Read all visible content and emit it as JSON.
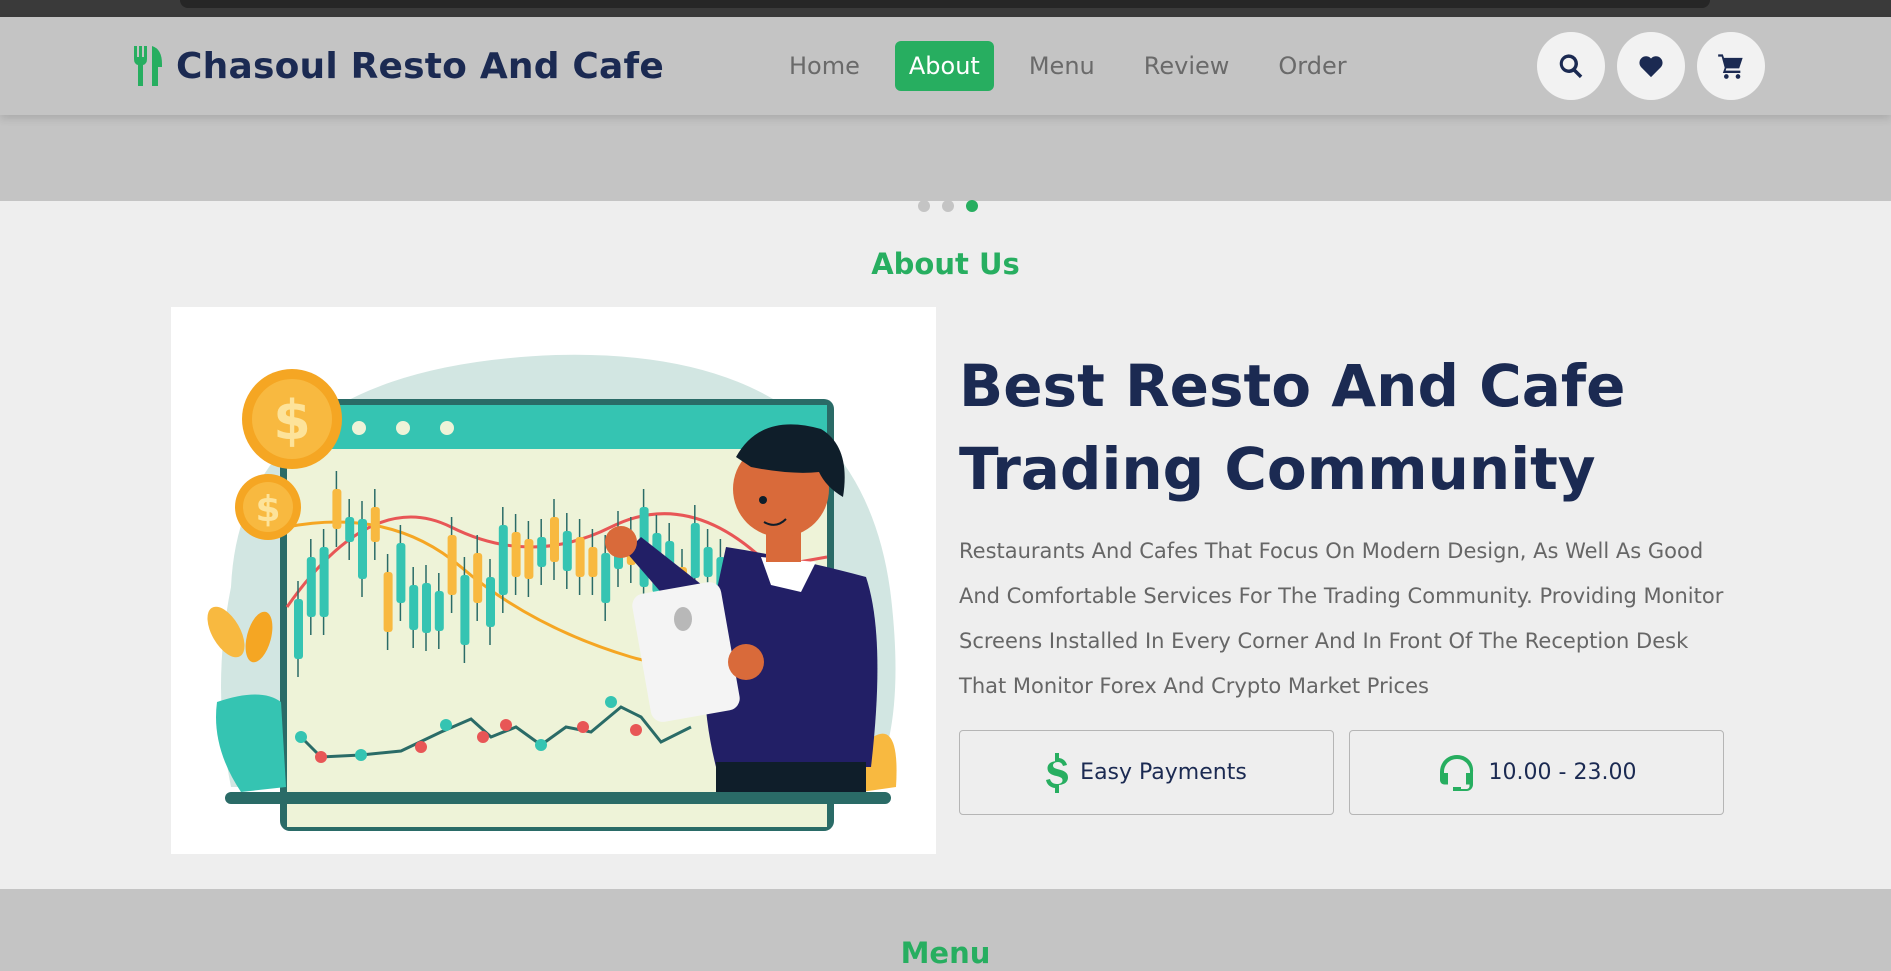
{
  "header": {
    "logo_text": "Chasoul Resto And Cafe",
    "logo_icon": "utensils-icon",
    "nav": [
      {
        "label": "Home",
        "active": false
      },
      {
        "label": "About",
        "active": true
      },
      {
        "label": "Menu",
        "active": false
      },
      {
        "label": "Review",
        "active": false
      },
      {
        "label": "Order",
        "active": false
      }
    ],
    "icons": [
      "search-icon",
      "heart-icon",
      "cart-icon"
    ]
  },
  "slider": {
    "dots": 3,
    "active_dot": 3
  },
  "about": {
    "section_title": "About Us",
    "headline_line1": "Best Resto And Cafe",
    "headline_line2": "Trading Community",
    "description": "Restaurants And Cafes That Focus On Modern Design, As Well As Good And Comfortable Services For The Trading Community. Providing Monitor Screens Installed In Every Corner And In Front Of The Reception Desk That Monitor Forex And Crypto Market Prices",
    "features": [
      {
        "icon": "dollar-icon",
        "label": "Easy Payments"
      },
      {
        "icon": "headset-icon",
        "label": "10.00 - 23.00"
      }
    ],
    "illustration_icon": "trader-chart-illustration"
  },
  "next_section": {
    "title": "Menu"
  },
  "colors": {
    "accent": "#27ae60",
    "navy": "#1b2a52",
    "header_bg": "#c4c4c4",
    "section_bg": "#eeeeee"
  }
}
